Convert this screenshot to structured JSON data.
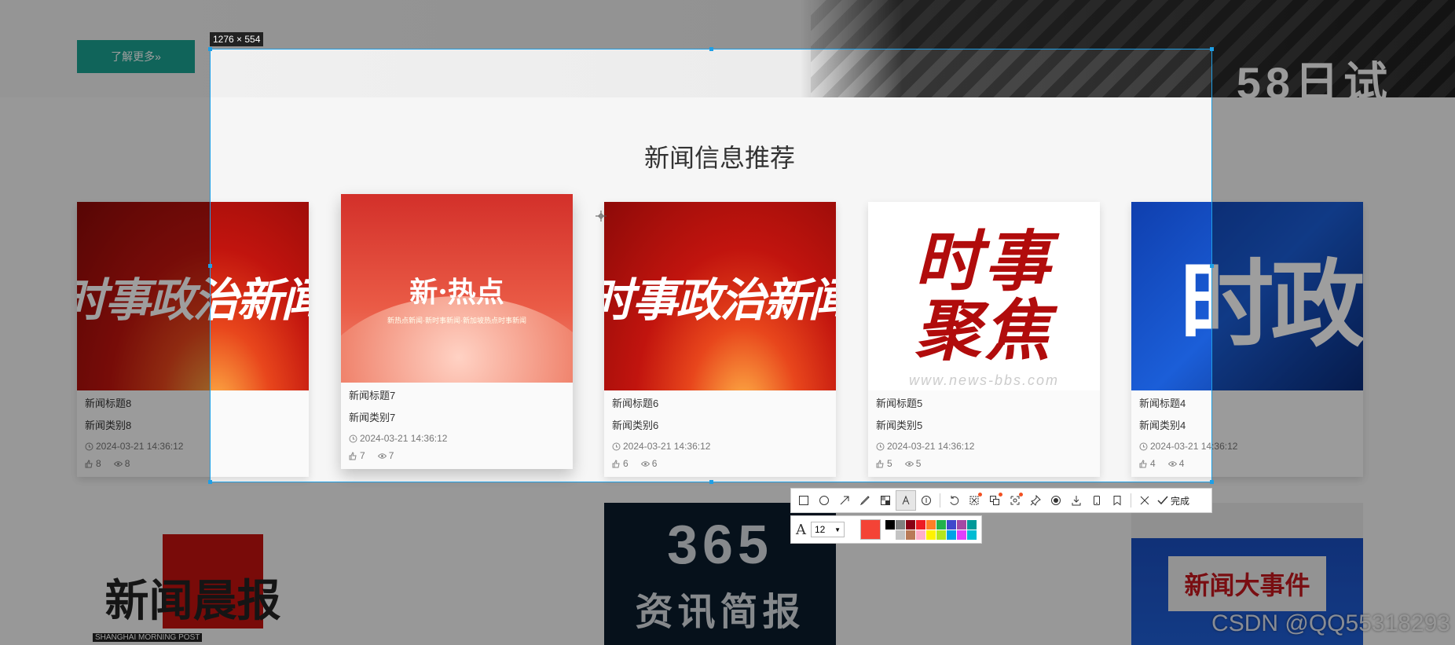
{
  "hero": {
    "more_button": "了解更多»",
    "digits": "58日试"
  },
  "section": {
    "title": "新闻信息推荐"
  },
  "cards": [
    {
      "thumb_text": "时事政治新闻",
      "title": "新闻标题8",
      "category": "新闻类别8",
      "date": "2024-03-21 14:36:12",
      "likes": "8",
      "views": "8"
    },
    {
      "thumb_text": "新·热点",
      "thumb_sub": "新热点新闻·新时事新闻·新加坡热点时事新闻",
      "title": "新闻标题7",
      "category": "新闻类别7",
      "date": "2024-03-21 14:36:12",
      "likes": "7",
      "views": "7"
    },
    {
      "thumb_text": "时事政治新闻",
      "title": "新闻标题6",
      "category": "新闻类别6",
      "date": "2024-03-21 14:36:12",
      "likes": "6",
      "views": "6"
    },
    {
      "thumb_line1": "时事",
      "thumb_line2": "聚焦",
      "thumb_url": "www.news-bbs.com",
      "title": "新闻标题5",
      "category": "新闻类别5",
      "date": "2024-03-21 14:36:12",
      "likes": "5",
      "views": "5"
    },
    {
      "thumb_text": "时政",
      "title": "新闻标题4",
      "category": "新闻类别4",
      "date": "2024-03-21 14:36:12",
      "likes": "4",
      "views": "4"
    }
  ],
  "lower": {
    "a_text": "新闻晨报",
    "a_sub": "SHANGHAI MORNING POST",
    "b_number": "365",
    "b_text": "资讯简报",
    "c_text": "新闻大事件"
  },
  "capture": {
    "size_label": "1276 × 554",
    "done_label": "完成",
    "font_size": "12",
    "current_color": "#f44336",
    "palette": [
      "#000000",
      "#7f7f7f",
      "#880015",
      "#ed1c24",
      "#ff7f27",
      "#22b14c",
      "#3f48cc",
      "#a349a4",
      "#009999",
      "#ffffff",
      "#c3c3c3",
      "#b97a57",
      "#ffaec9",
      "#fff200",
      "#b5e61d",
      "#00a2e8",
      "#e040fb",
      "#00bcd4"
    ]
  },
  "watermark": "CSDN @QQ55318293"
}
